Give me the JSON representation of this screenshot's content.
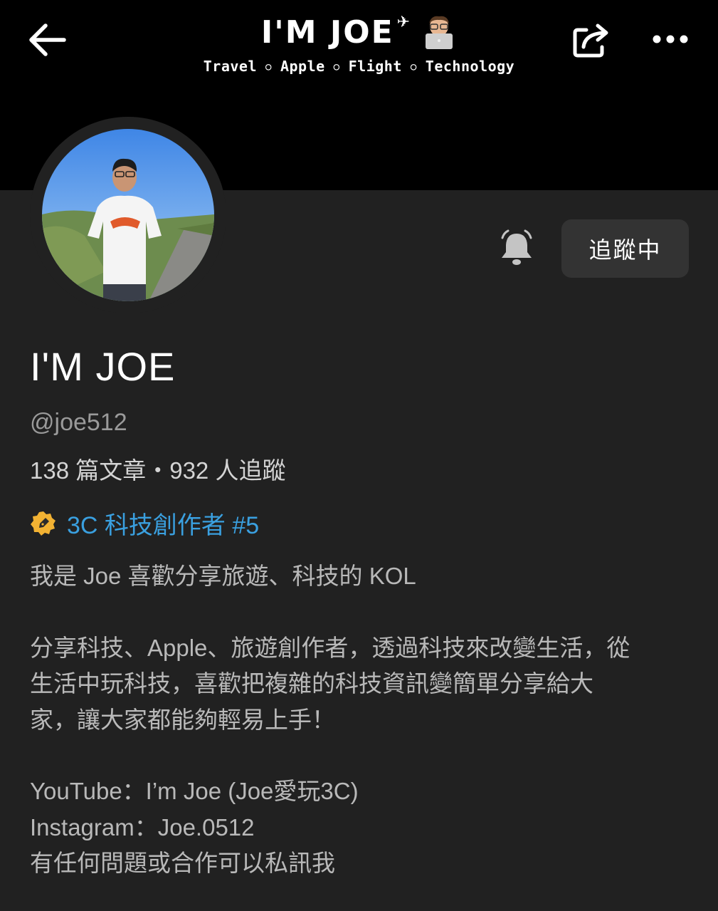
{
  "header": {
    "brand_title": "I'M JOE",
    "tags": [
      "Travel",
      "Apple",
      "Flight",
      "Technology"
    ],
    "colors": {
      "banner": "#000000",
      "page": "#212121"
    }
  },
  "toolbar": {
    "back_icon": "arrow-left-icon",
    "share_icon": "share-icon",
    "more_icon": "more-horizontal-icon"
  },
  "profile": {
    "display_name": "I'M JOE",
    "handle": "@joe512",
    "stats": "138 篇文章・932 人追蹤",
    "badge_label": "3C 科技創作者 #5",
    "badge_color": "#3aa0e0",
    "follow_button": "追蹤中",
    "bell_icon": "bell-icon"
  },
  "bio": {
    "line1": "我是 Joe 喜歡分享旅遊、科技的 KOL",
    "para2_line1": "分享科技、Apple、旅遊創作者，透過科技來改變生活，從",
    "para2_line2": "生活中玩科技，喜歡把複雜的科技資訊變簡單分享給大",
    "para2_line3": "家，讓大家都能夠輕易上手！",
    "youtube": "YouTube：I’m Joe (Joe愛玩3C)",
    "instagram": "Instagram：Joe.0512",
    "contact": "有任何問題或合作可以私訊我"
  }
}
